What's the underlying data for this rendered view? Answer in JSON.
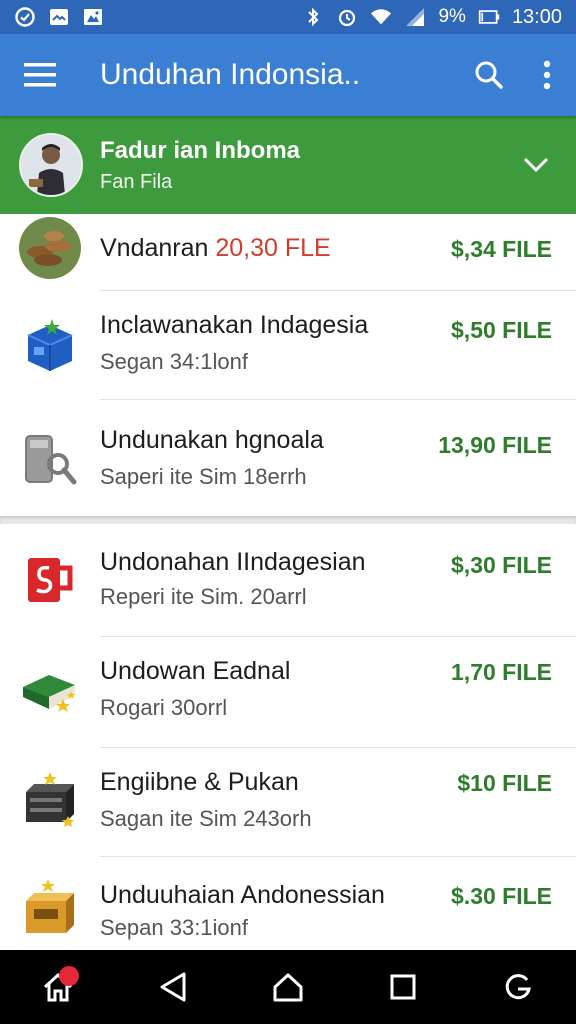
{
  "status_bar": {
    "battery": "9%",
    "time": "13:00",
    "left_icons": [
      "clock-check-icon",
      "image-icon",
      "photo-icon"
    ],
    "right_icons": [
      "bluetooth-icon",
      "alarm-icon",
      "wifi-icon",
      "signal-icon",
      "battery-icon"
    ]
  },
  "toolbar": {
    "title": "Unduhan Indonsia..",
    "icons": [
      "menu-icon",
      "search-icon",
      "more-vert-icon"
    ]
  },
  "account": {
    "name": "Fadur ian Inboma",
    "subtitle": "Fan Fila"
  },
  "items": [
    {
      "title": "Vndanran ",
      "title_red": "20,30 FLE",
      "subtitle": "",
      "price": "$,34 FILE",
      "icon": "wood-logs-icon"
    },
    {
      "title": "Inclawanakan Indagesia",
      "subtitle": "Segan 34:1lonf",
      "price": "$,50 FILE",
      "icon": "blue-box-icon"
    },
    {
      "title": "Undunakan hgnoala",
      "subtitle": "Saperi ite Sim 18errh",
      "price": "13,90 FILE",
      "icon": "gray-device-search-icon"
    },
    {
      "title": "Undonahan IIndagesian",
      "subtitle": "Reperi ite Sim. 20arrl",
      "price": "$,30 FILE",
      "icon": "red-mug-icon"
    },
    {
      "title": "Undowan Eadnal",
      "subtitle": "Rogari 30orrl",
      "price": "1,70 FILE",
      "icon": "green-book-icon"
    },
    {
      "title": "Engiibne & Pukan",
      "subtitle": "Sagan ite Sim 243orh",
      "price": "$10 FILE",
      "icon": "dark-chest-icon"
    },
    {
      "title": "Unduuhaian Andonessian",
      "subtitle": "Sepan 33:1ionf",
      "price": "$.30 FILE",
      "icon": "gold-chest-icon"
    }
  ],
  "navbar": {
    "icons": [
      "home-icon",
      "back-icon",
      "home-circle-icon",
      "recents-icon",
      "assistant-icon"
    ]
  },
  "colors": {
    "status_bar": "#2f67b8",
    "toolbar": "#3b7fd4",
    "account_header": "#3d9a3d",
    "price": "#2d7d2d",
    "red_text": "#d33b2c"
  }
}
